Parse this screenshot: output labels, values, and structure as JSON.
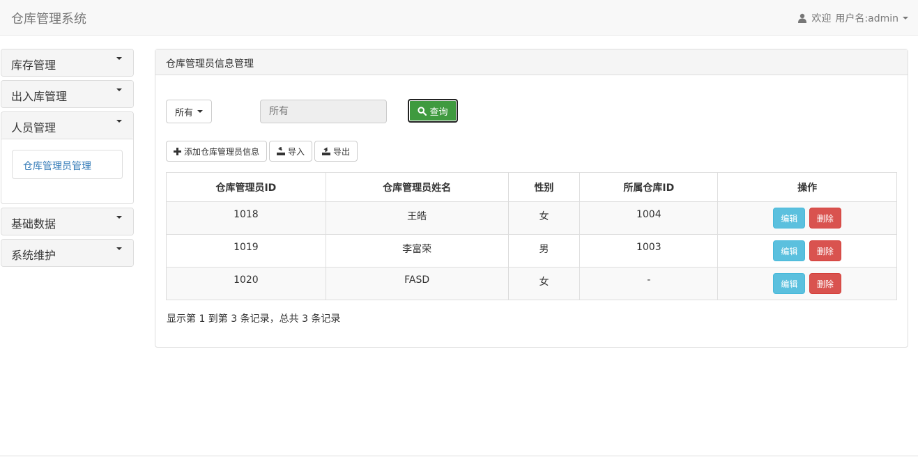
{
  "app": {
    "title": "仓库管理系统",
    "welcome": "欢迎",
    "user_label": "用户名:admin"
  },
  "sidebar": {
    "groups": [
      {
        "label": "库存管理"
      },
      {
        "label": "出入库管理"
      },
      {
        "label": "人员管理",
        "items": [
          {
            "label": "仓库管理员管理"
          }
        ]
      },
      {
        "label": "基础数据"
      },
      {
        "label": "系统维护"
      }
    ]
  },
  "main": {
    "panel_title": "仓库管理员信息管理",
    "filter_label": "所有",
    "search_placeholder": "所有",
    "query_label": "查询",
    "toolbar": {
      "add_label": "添加仓库管理员信息",
      "import_label": "导入",
      "export_label": "导出"
    },
    "table": {
      "headers": [
        "仓库管理员ID",
        "仓库管理员姓名",
        "性别",
        "所属仓库ID",
        "操作"
      ],
      "rows": [
        {
          "id": "1018",
          "name": "王皓",
          "sex": "女",
          "repo": "1004"
        },
        {
          "id": "1019",
          "name": "李富荣",
          "sex": "男",
          "repo": "1003"
        },
        {
          "id": "1020",
          "name": "FASD",
          "sex": "女",
          "repo": "-"
        }
      ],
      "edit_label": "编辑",
      "delete_label": "删除"
    },
    "summary": "显示第 1 到第 3 条记录，总共 3 条记录"
  },
  "colors": {
    "query_green": "#3f9a3f",
    "edit_blue": "#5bc0de",
    "delete_red": "#d9534f",
    "link_blue": "#337ab7"
  }
}
